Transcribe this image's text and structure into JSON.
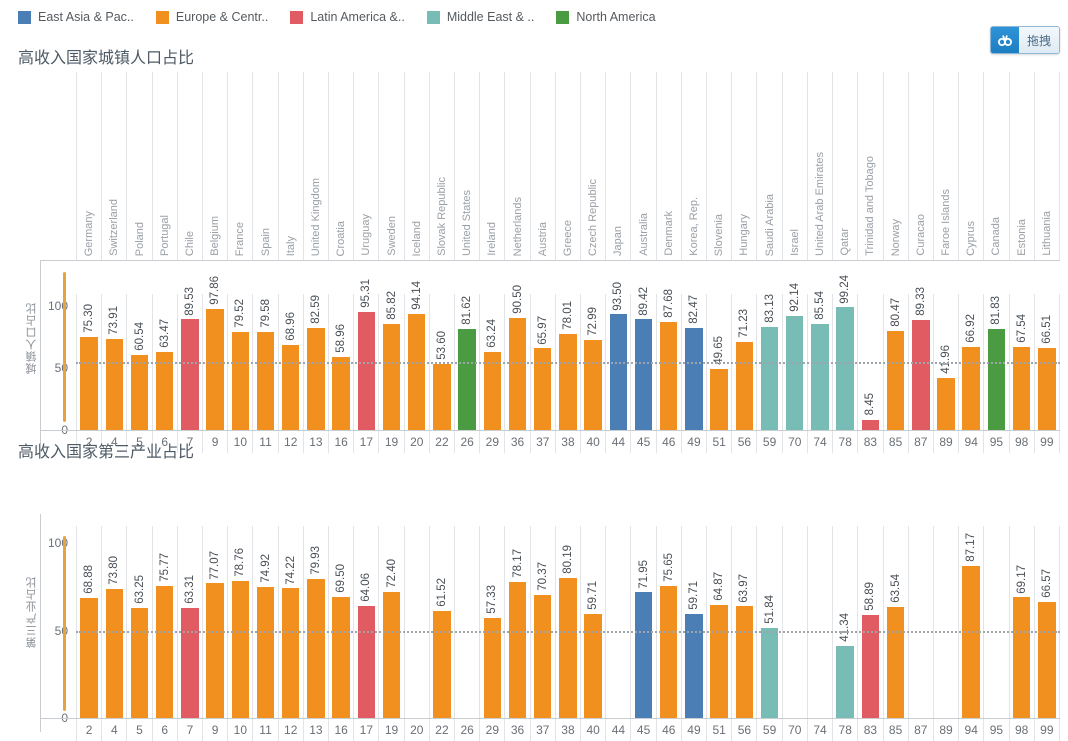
{
  "legend": {
    "items": [
      {
        "label": "East Asia & Pac..",
        "color": "#4a7eb5"
      },
      {
        "label": "Europe & Centr..",
        "color": "#f1901e"
      },
      {
        "label": "Latin America &..",
        "color": "#e15b62"
      },
      {
        "label": "Middle East & ..",
        "color": "#78bdb5"
      },
      {
        "label": "North America",
        "color": "#4a9b42"
      }
    ]
  },
  "toolbar": {
    "pan_label": "拖拽",
    "pan_icon": "pan-icon"
  },
  "colors": {
    "east_asia": "#4a7eb5",
    "europe": "#f1901e",
    "latin_america": "#e15b62",
    "middle_east": "#78bdb5",
    "north_america": "#4a9b42",
    "grid": "#e2e4e7",
    "axis": "#c9ccd0",
    "refline": "#9ea4ab",
    "accent": "#e8a33d"
  },
  "chart_data": [
    {
      "type": "bar",
      "title": "高收入国家城镇人口占比",
      "xlabel": "",
      "ylabel": "城镇人口占比",
      "ylim": [
        0,
        110
      ],
      "yticks": [
        0,
        50,
        100
      ],
      "grid": true,
      "refline": 55,
      "legend_position": "top",
      "categories": [
        "2",
        "4",
        "5",
        "6",
        "7",
        "9",
        "10",
        "11",
        "12",
        "13",
        "16",
        "17",
        "19",
        "20",
        "22",
        "26",
        "29",
        "36",
        "37",
        "38",
        "40",
        "44",
        "45",
        "46",
        "49",
        "51",
        "56",
        "59",
        "70",
        "74",
        "78",
        "83",
        "85",
        "87",
        "89",
        "94",
        "95",
        "98",
        "99"
      ],
      "names": [
        "Germany",
        "Switzerland",
        "Poland",
        "Portugal",
        "Chile",
        "Belgium",
        "France",
        "Spain",
        "Italy",
        "United Kingdom",
        "Croatia",
        "Uruguay",
        "Sweden",
        "Iceland",
        "Slovak Republic",
        "United States",
        "Ireland",
        "Netherlands",
        "Austria",
        "Greece",
        "Czech Republic",
        "Japan",
        "Australia",
        "Denmark",
        "Korea, Rep.",
        "Slovenia",
        "Hungary",
        "Saudi Arabia",
        "Israel",
        "United Arab Emirates",
        "Qatar",
        "Trinidad and Tobago",
        "Norway",
        "Curacao",
        "Faroe Islands",
        "Cyprus",
        "Canada",
        "Estonia",
        "Lithuania"
      ],
      "values": [
        75.3,
        73.91,
        60.54,
        63.47,
        89.53,
        97.86,
        79.52,
        79.58,
        68.96,
        82.59,
        58.96,
        95.31,
        85.82,
        94.14,
        53.6,
        81.62,
        63.24,
        90.5,
        65.97,
        78.01,
        72.99,
        93.5,
        89.42,
        87.68,
        82.47,
        49.65,
        71.23,
        83.13,
        92.14,
        85.54,
        99.24,
        8.45,
        80.47,
        89.33,
        41.96,
        66.92,
        81.83,
        67.54,
        66.51
      ],
      "regions": [
        "europe",
        "europe",
        "europe",
        "europe",
        "latin_america",
        "europe",
        "europe",
        "europe",
        "europe",
        "europe",
        "europe",
        "latin_america",
        "europe",
        "europe",
        "europe",
        "north_america",
        "europe",
        "europe",
        "europe",
        "europe",
        "europe",
        "east_asia",
        "east_asia",
        "europe",
        "east_asia",
        "europe",
        "europe",
        "middle_east",
        "middle_east",
        "middle_east",
        "middle_east",
        "latin_america",
        "europe",
        "latin_america",
        "europe",
        "europe",
        "north_america",
        "europe",
        "europe"
      ]
    },
    {
      "type": "bar",
      "title": "高收入国家第三产业占比",
      "xlabel": "",
      "ylabel": "第三产业占比",
      "ylim": [
        0,
        110
      ],
      "yticks": [
        0,
        50,
        100
      ],
      "grid": true,
      "refline": 50,
      "legend_position": "top",
      "categories": [
        "2",
        "4",
        "5",
        "6",
        "7",
        "9",
        "10",
        "11",
        "12",
        "13",
        "16",
        "17",
        "19",
        "20",
        "22",
        "26",
        "29",
        "36",
        "37",
        "38",
        "40",
        "44",
        "45",
        "46",
        "49",
        "51",
        "56",
        "59",
        "70",
        "74",
        "78",
        "83",
        "85",
        "87",
        "89",
        "94",
        "95",
        "98",
        "99"
      ],
      "names": [
        "Germany",
        "Switzerland",
        "Poland",
        "Portugal",
        "Chile",
        "Belgium",
        "France",
        "Spain",
        "Italy",
        "United Kingdom",
        "Croatia",
        "Uruguay",
        "Sweden",
        "Iceland",
        "Slovak Republic",
        "United States",
        "Ireland",
        "Netherlands",
        "Austria",
        "Greece",
        "Czech Republic",
        "Japan",
        "Australia",
        "Denmark",
        "Korea, Rep.",
        "Slovenia",
        "Hungary",
        "Saudi Arabia",
        "Israel",
        "United Arab Emirates",
        "Qatar",
        "Trinidad and Tobago",
        "Norway",
        "Curacao",
        "Faroe Islands",
        "Cyprus",
        "Canada",
        "Estonia",
        "Lithuania"
      ],
      "values": [
        68.88,
        73.8,
        63.25,
        75.77,
        63.31,
        77.07,
        78.76,
        74.92,
        74.22,
        79.93,
        69.5,
        64.06,
        72.4,
        null,
        61.52,
        null,
        57.33,
        78.17,
        70.37,
        80.19,
        59.71,
        null,
        71.95,
        75.65,
        59.71,
        64.87,
        63.97,
        51.84,
        null,
        null,
        41.34,
        58.89,
        63.54,
        null,
        null,
        87.17,
        null,
        69.17,
        66.57
      ],
      "regions": [
        "europe",
        "europe",
        "europe",
        "europe",
        "latin_america",
        "europe",
        "europe",
        "europe",
        "europe",
        "europe",
        "europe",
        "latin_america",
        "europe",
        "europe",
        "europe",
        "north_america",
        "europe",
        "europe",
        "europe",
        "europe",
        "europe",
        "east_asia",
        "east_asia",
        "europe",
        "east_asia",
        "europe",
        "europe",
        "middle_east",
        "middle_east",
        "middle_east",
        "middle_east",
        "latin_america",
        "europe",
        "latin_america",
        "europe",
        "europe",
        "north_america",
        "europe",
        "europe"
      ]
    }
  ]
}
